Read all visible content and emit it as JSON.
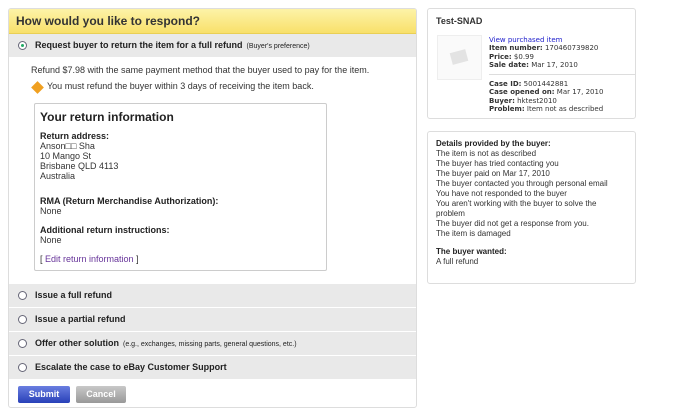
{
  "left": {
    "title": "How would you like to respond?",
    "options": [
      {
        "label": "Request buyer to return the item for a full refund",
        "note": "(Buyer's preference)",
        "selected": true
      },
      {
        "label": "Issue a full refund",
        "note": "",
        "selected": false
      },
      {
        "label": "Issue a partial refund",
        "note": "",
        "selected": false
      },
      {
        "label": "Offer other solution",
        "note": "(e.g., exchanges, missing parts, general questions, etc.)",
        "selected": false
      },
      {
        "label": "Escalate the case to eBay Customer Support",
        "note": "",
        "selected": false
      }
    ],
    "refund_text": "Refund $7.98 with the same payment method that the buyer used to pay for the item.",
    "warning_text": "You must refund the buyer within 3 days of receiving the item back.",
    "return_info": {
      "title": "Your return information",
      "address_label": "Return address:",
      "address": [
        "Anson□□ Sha",
        "10 Mango St",
        "Brisbane QLD 4113",
        "Australia"
      ],
      "rma_label": "RMA (Return Merchandise Authorization):",
      "rma_value": "None",
      "instructions_label": "Additional return instructions:",
      "instructions_value": "None",
      "edit_open": "[ ",
      "edit_link": "Edit return information",
      "edit_close": " ]"
    },
    "submit": "Submit",
    "cancel": "Cancel"
  },
  "item": {
    "title": "Test-SNAD",
    "view_link": "View purchased item",
    "item_number_label": "Item number:",
    "item_number": "170460739820",
    "price_label": "Price:",
    "price": "$0.99",
    "sale_date_label": "Sale date:",
    "sale_date": "Mar 17, 2010",
    "case_id_label": "Case ID:",
    "case_id": "5001442881",
    "case_opened_label": "Case opened on:",
    "case_opened": "Mar 17, 2010",
    "buyer_label": "Buyer:",
    "buyer": "hktest2010",
    "problem_label": "Problem:",
    "problem": "Item not as described"
  },
  "details": {
    "title": "Details provided by the buyer:",
    "lines": [
      "The item is not as described",
      "The buyer has tried contacting you",
      "The buyer paid on Mar 17, 2010",
      "The buyer contacted you through personal email",
      "You have not responded to the buyer",
      "You aren't working with the buyer to solve the problem",
      "The buyer did not get a response from you.",
      "The item is damaged"
    ],
    "wanted_label": "The buyer wanted:",
    "wanted": "A full refund"
  }
}
